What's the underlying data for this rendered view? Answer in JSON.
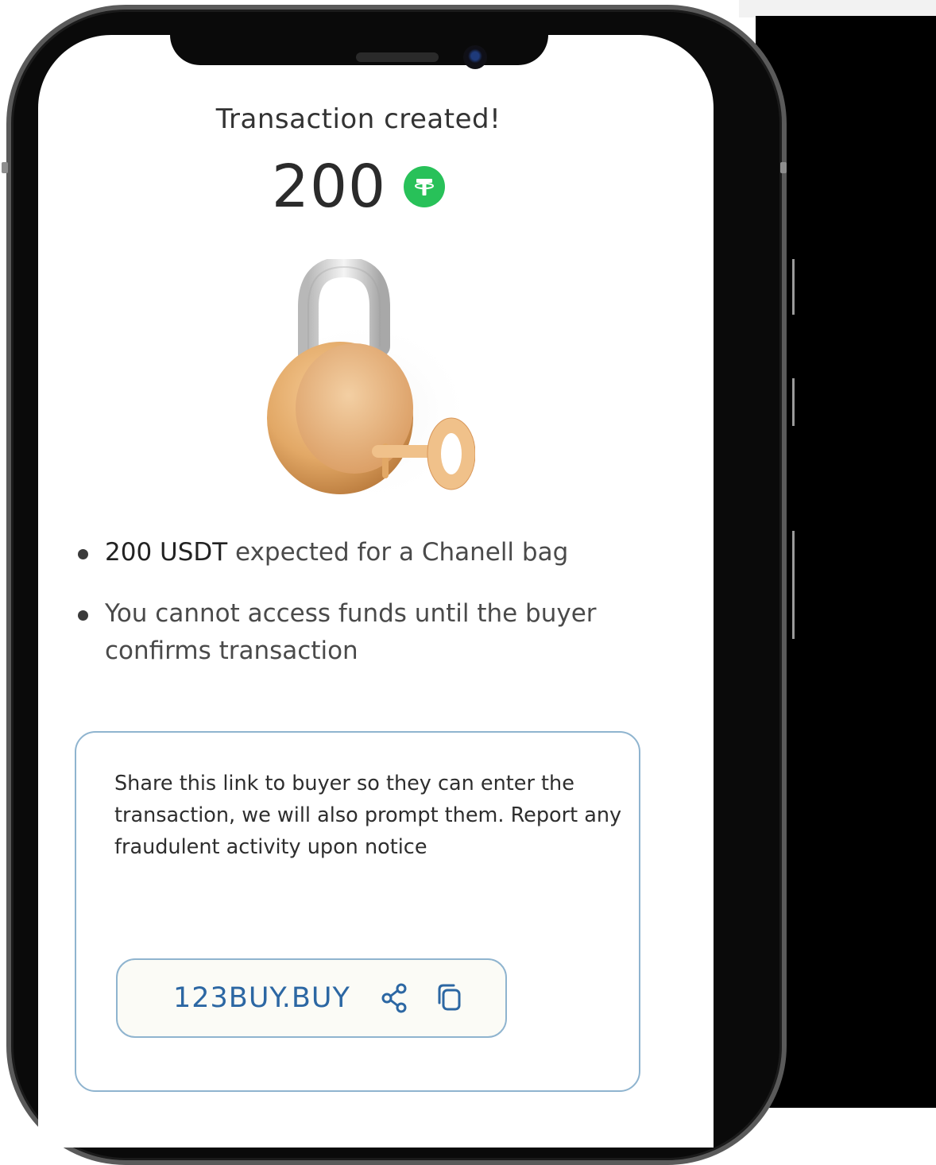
{
  "screen": {
    "title": "Transaction created!",
    "amount": "200",
    "currency_icon": "tether-usdt-icon"
  },
  "illustration": {
    "name": "padlock-with-key-icon"
  },
  "bullets": [
    {
      "strong": "200 USDT",
      "rest": " expected for a Chanell bag"
    },
    {
      "text": "You cannot access funds until the buyer confirms transaction"
    }
  ],
  "share": {
    "text": "Share this link to buyer so they can enter the transaction, we will also prompt them. Report any fraudulent activity upon notice",
    "link": "123BUY.BUY",
    "share_icon": "share-icon",
    "copy_icon": "copy-icon"
  },
  "colors": {
    "usdt_green": "#28c159",
    "link_blue": "#2c67a3",
    "border_blue": "#8fb4cf",
    "lock_gold": "#e2a866"
  }
}
